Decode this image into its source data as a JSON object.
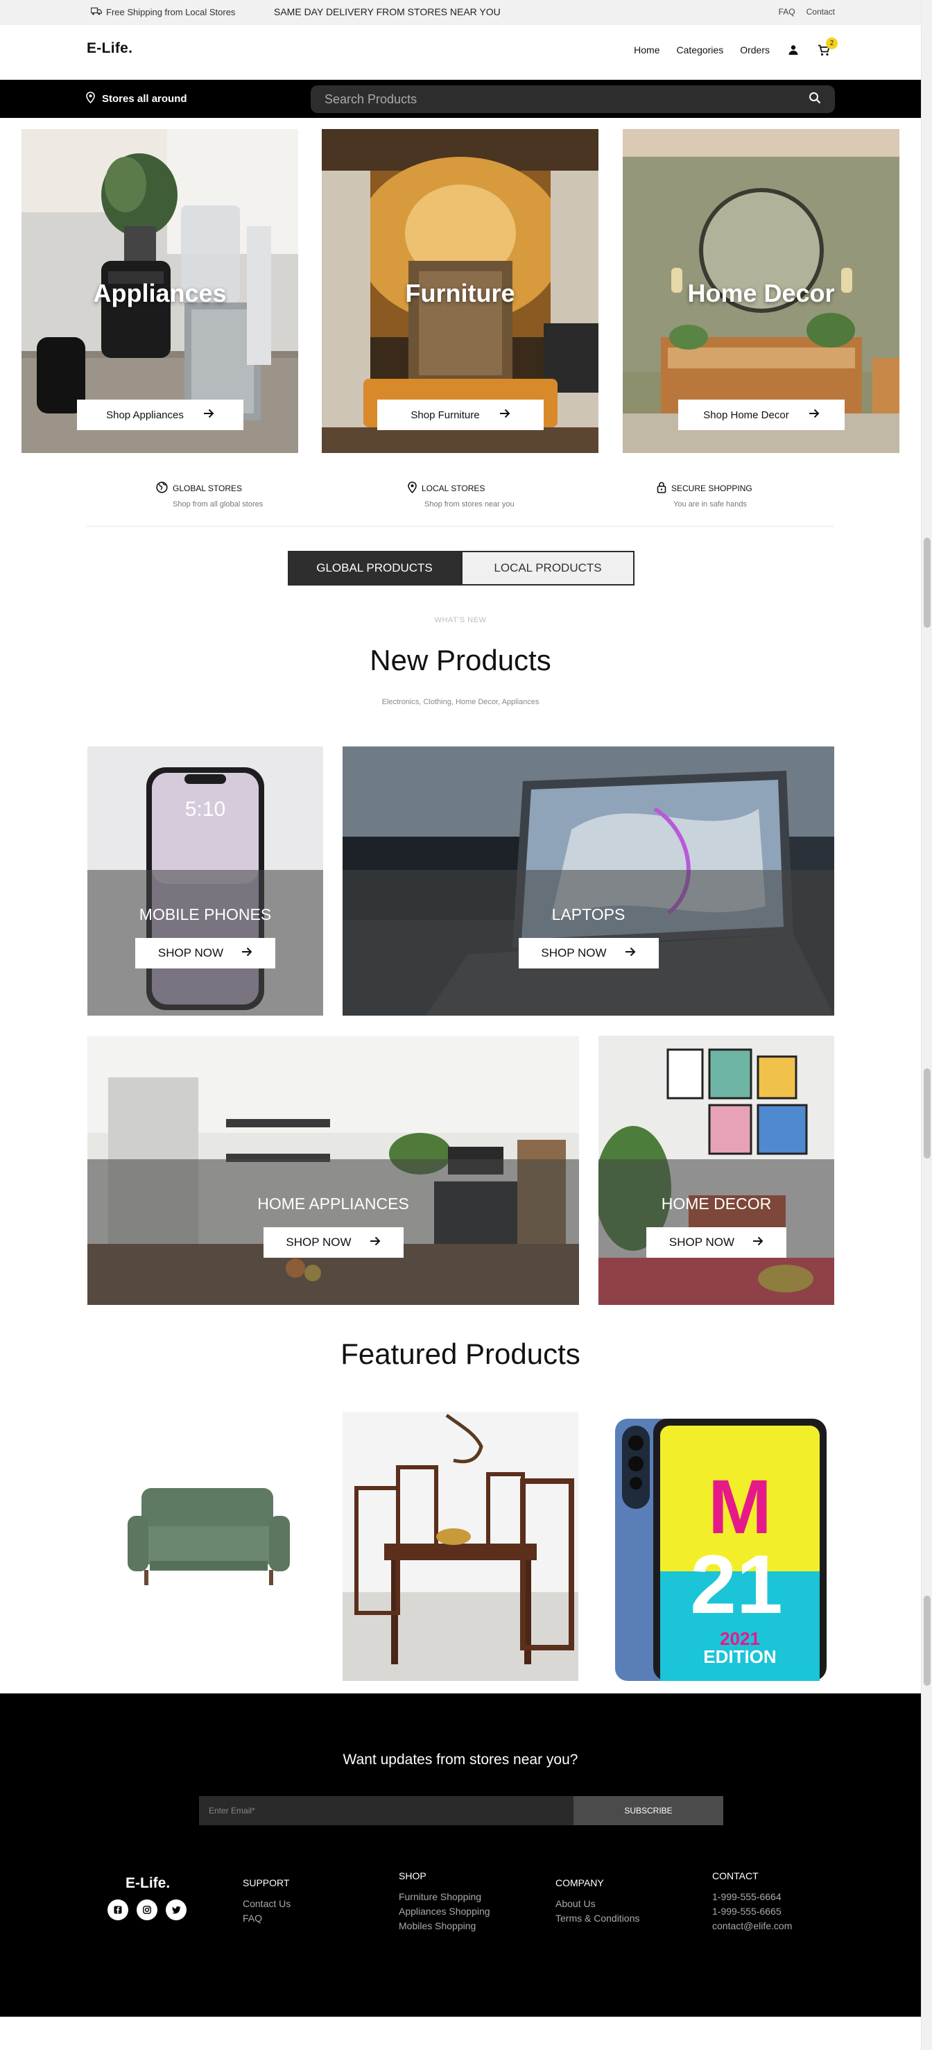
{
  "topbar": {
    "shipping": "Free Shipping from Local Stores",
    "same_day": "SAME DAY DELIVERY FROM STORES NEAR YOU",
    "faq": "FAQ",
    "contact": "Contact"
  },
  "header": {
    "logo": "E-Life.",
    "nav": [
      "Home",
      "Categories",
      "Orders"
    ],
    "cart_count": "2"
  },
  "searchbar": {
    "location": "Stores all around",
    "placeholder": "Search Products"
  },
  "categories": [
    {
      "title": "Appliances",
      "button": "Shop Appliances"
    },
    {
      "title": "Furniture",
      "button": "Shop Furniture"
    },
    {
      "title": "Home Decor",
      "button": "Shop Home Decor"
    }
  ],
  "features": [
    {
      "icon": "globe-icon",
      "title": "GLOBAL STORES",
      "subtitle": "Shop from all global stores"
    },
    {
      "icon": "map-pin-icon",
      "title": "LOCAL STORES",
      "subtitle": "Shop from stores near you"
    },
    {
      "icon": "lock-icon",
      "title": "SECURE SHOPPING",
      "subtitle": "You are in safe hands"
    }
  ],
  "tabs": {
    "global": "GLOBAL PRODUCTS",
    "local": "LOCAL PRODUCTS"
  },
  "new_products": {
    "eyebrow": "WHAT'S NEW",
    "title": "New Products",
    "subtitle": "Electronics, Clothing, Home Decor, Appliances",
    "tiles": [
      {
        "label": "MOBILE PHONES",
        "button": "SHOP NOW"
      },
      {
        "label": "LAPTOPS",
        "button": "SHOP NOW"
      },
      {
        "label": "HOME APPLIANCES",
        "button": "SHOP NOW"
      },
      {
        "label": "HOME DECOR",
        "button": "SHOP NOW"
      }
    ]
  },
  "featured": {
    "title": "Featured Products",
    "phone_model": "M21",
    "phone_edition": "2021 EDITION"
  },
  "footer": {
    "newsletter_title": "Want updates from stores near you?",
    "email_placeholder": "Enter Email*",
    "subscribe": "SUBSCRIBE",
    "logo": "E-Life.",
    "support": {
      "heading": "SUPPORT",
      "links": [
        "Contact Us",
        "FAQ"
      ]
    },
    "shop": {
      "heading": "SHOP",
      "links": [
        "Furniture Shopping",
        "Appliances Shopping",
        "Mobiles Shopping"
      ]
    },
    "company": {
      "heading": "COMPANY",
      "links": [
        "About Us",
        "Terms & Conditions"
      ]
    },
    "contact": {
      "heading": "CONTACT",
      "links": [
        "1-999-555-6664",
        "1-999-555-6665",
        "contact@elife.com"
      ]
    }
  },
  "colors": {
    "accent": "#f5d31a",
    "black": "#000000",
    "tab_active": "#2e2e2e"
  }
}
